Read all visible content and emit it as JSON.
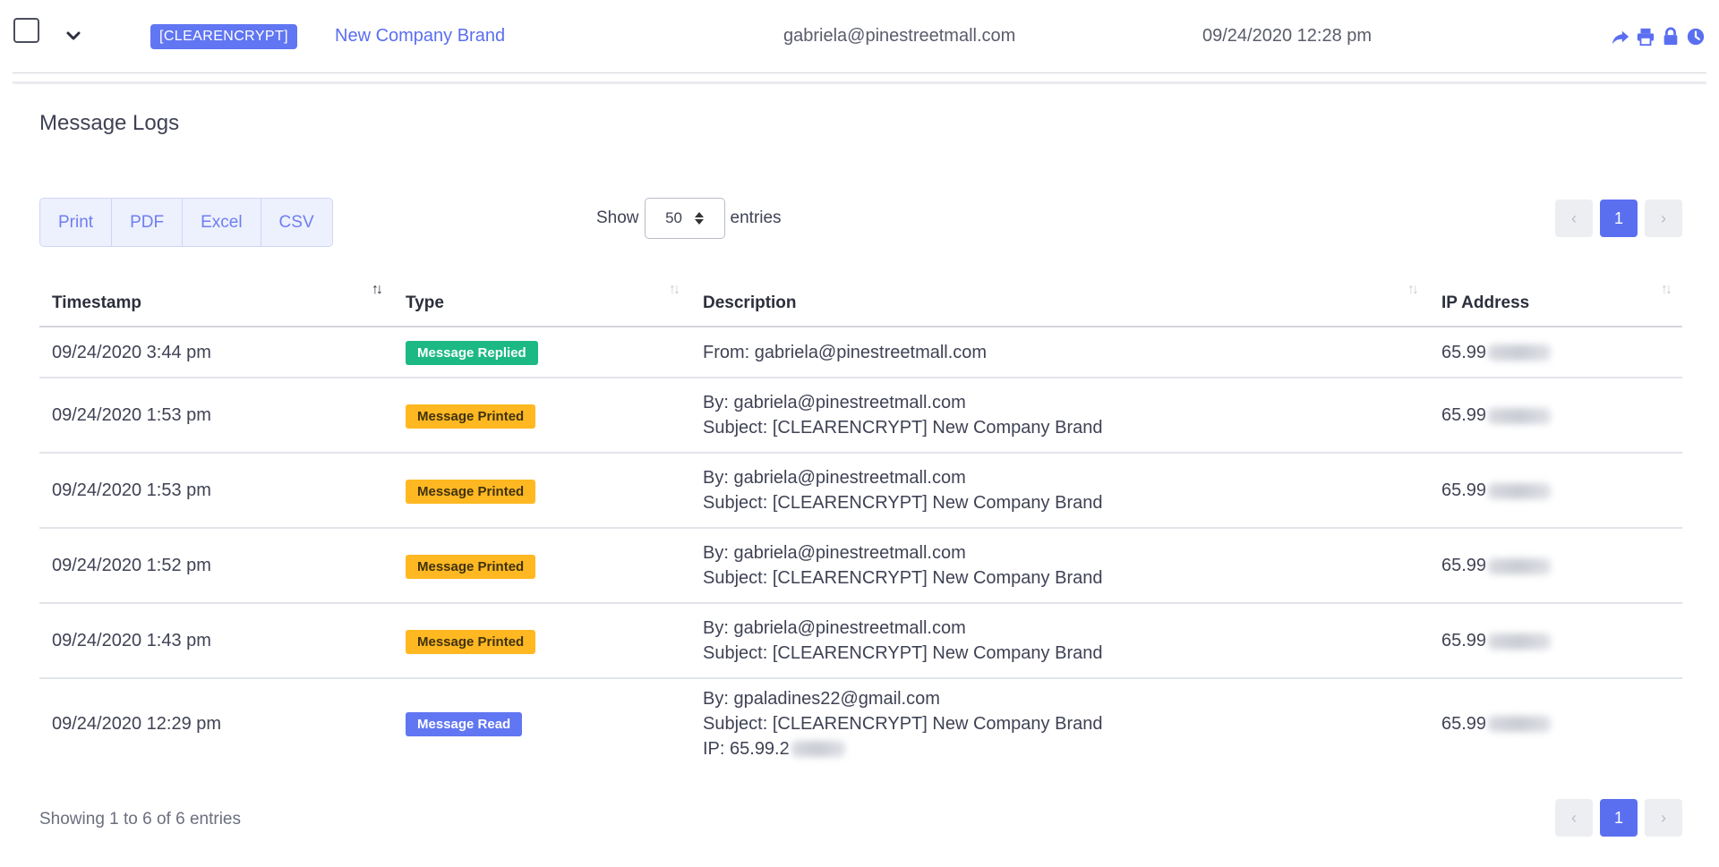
{
  "message_row": {
    "tag": "[CLEARENCRYPT]",
    "subject": "New Company Brand",
    "email": "gabriela@pinestreetmall.com",
    "date": "09/24/2020 12:28 pm",
    "actions": [
      "forward-icon",
      "print-icon",
      "lock-icon",
      "clock-icon"
    ]
  },
  "section": {
    "title": "Message Logs"
  },
  "export_buttons": [
    {
      "label": "Print"
    },
    {
      "label": "PDF"
    },
    {
      "label": "Excel"
    },
    {
      "label": "CSV"
    }
  ],
  "length": {
    "show_label": "Show",
    "value": "50",
    "entries_label": "entries"
  },
  "pagination": {
    "prev": "‹",
    "current": "1",
    "next": "›"
  },
  "table": {
    "columns": [
      "Timestamp",
      "Type",
      "Description",
      "IP Address"
    ],
    "rows": [
      {
        "timestamp": "09/24/2020 3:44 pm",
        "type": "Message Replied",
        "desc": [
          "From: gabriela@pinestreetmall.com"
        ],
        "ip": "65.99"
      },
      {
        "timestamp": "09/24/2020 1:53 pm",
        "type": "Message Printed",
        "desc": [
          "By: gabriela@pinestreetmall.com",
          "Subject: [CLEARENCRYPT] New Company Brand"
        ],
        "ip": "65.99"
      },
      {
        "timestamp": "09/24/2020 1:53 pm",
        "type": "Message Printed",
        "desc": [
          "By: gabriela@pinestreetmall.com",
          "Subject: [CLEARENCRYPT] New Company Brand"
        ],
        "ip": "65.99"
      },
      {
        "timestamp": "09/24/2020 1:52 pm",
        "type": "Message Printed",
        "desc": [
          "By: gabriela@pinestreetmall.com",
          "Subject: [CLEARENCRYPT] New Company Brand"
        ],
        "ip": "65.99"
      },
      {
        "timestamp": "09/24/2020 1:43 pm",
        "type": "Message Printed",
        "desc": [
          "By: gabriela@pinestreetmall.com",
          "Subject: [CLEARENCRYPT] New Company Brand"
        ],
        "ip": "65.99"
      },
      {
        "timestamp": "09/24/2020 12:29 pm",
        "type": "Message Read",
        "desc": [
          "By: gpaladines22@gmail.com",
          "Subject: [CLEARENCRYPT] New Company Brand",
          "IP: 65.99.2"
        ],
        "ip": "65.99"
      }
    ]
  },
  "info": "Showing 1 to 6 of 6 entries",
  "colors": {
    "accent": "#5a6ff0",
    "replied": "#1cb985",
    "printed": "#ffb822",
    "read": "#6176f2"
  }
}
